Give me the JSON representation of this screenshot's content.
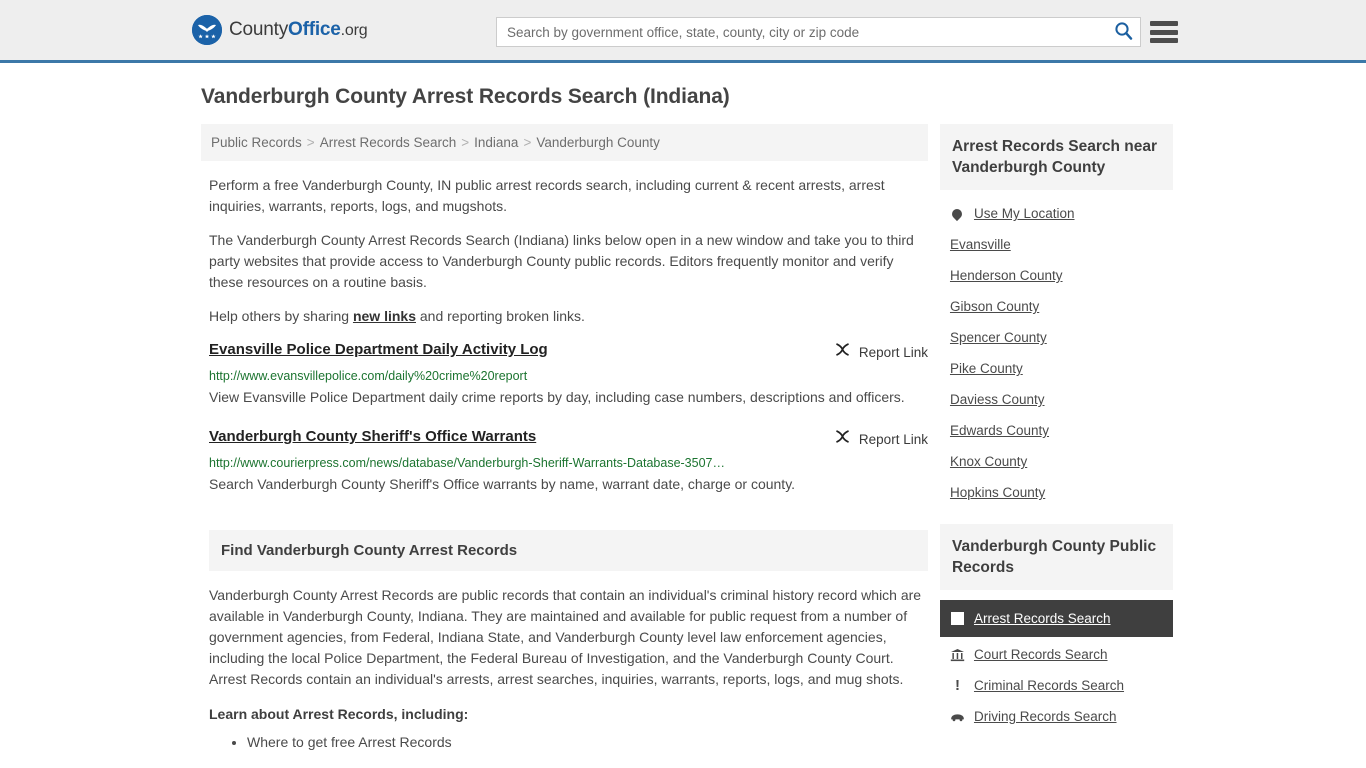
{
  "header": {
    "logo": {
      "icon": "eagle-seal-icon",
      "text_county": "County",
      "text_office": "Office",
      "text_org": ".org"
    },
    "search": {
      "placeholder": "Search by government office, state, county, city or zip code",
      "value": "",
      "icon": "search-icon"
    },
    "menu_icon": "hamburger-menu-icon"
  },
  "page": {
    "title": "Vanderburgh County Arrest Records Search (Indiana)"
  },
  "breadcrumb": {
    "separator": ">",
    "items": [
      {
        "label": "Public Records"
      },
      {
        "label": "Arrest Records Search"
      },
      {
        "label": "Indiana"
      },
      {
        "label": "Vanderburgh County"
      }
    ]
  },
  "intro": {
    "p1": "Perform a free Vanderburgh County, IN public arrest records search, including current & recent arrests, arrest inquiries, warrants, reports, logs, and mugshots.",
    "p2": "The Vanderburgh County Arrest Records Search (Indiana) links below open in a new window and take you to third party websites that provide access to Vanderburgh County public records. Editors frequently monitor and verify these resources on a routine basis.",
    "p3_before": "Help others by sharing ",
    "p3_link": "new links",
    "p3_after": " and reporting broken links."
  },
  "results": {
    "report_label": "Report Link",
    "report_icon": "broken-link-icon",
    "items": [
      {
        "title": "Evansville Police Department Daily Activity Log",
        "url": "http://www.evansvillepolice.com/daily%20crime%20report",
        "description": "View Evansville Police Department daily crime reports by day, including case numbers, descriptions and officers."
      },
      {
        "title": "Vanderburgh County Sheriff's Office Warrants",
        "url": "http://www.courierpress.com/news/database/Vanderburgh-Sheriff-Warrants-Database-3507…",
        "description": "Search Vanderburgh County Sheriff's Office warrants by name, warrant date, charge or county."
      }
    ]
  },
  "find_section": {
    "heading": "Find Vanderburgh County Arrest Records",
    "body": "Vanderburgh County Arrest Records are public records that contain an individual's criminal history record which are available in Vanderburgh County, Indiana. They are maintained and available for public request from a number of government agencies, from Federal, Indiana State, and Vanderburgh County level law enforcement agencies, including the local Police Department, the Federal Bureau of Investigation, and the Vanderburgh County Court. Arrest Records contain an individual's arrests, arrest searches, inquiries, warrants, reports, logs, and mug shots.",
    "learn_heading": "Learn about Arrest Records, including:",
    "learn_items": [
      "Where to get free Arrest Records"
    ]
  },
  "sidebar": {
    "nearby": {
      "heading": "Arrest Records Search near Vanderburgh County",
      "items": [
        {
          "label": "Use My Location",
          "icon": "map-pin-icon"
        },
        {
          "label": "Evansville",
          "icon": ""
        },
        {
          "label": "Henderson County",
          "icon": ""
        },
        {
          "label": "Gibson County",
          "icon": ""
        },
        {
          "label": "Spencer County",
          "icon": ""
        },
        {
          "label": "Pike County",
          "icon": ""
        },
        {
          "label": "Daviess County",
          "icon": ""
        },
        {
          "label": "Edwards County",
          "icon": ""
        },
        {
          "label": "Knox County",
          "icon": ""
        },
        {
          "label": "Hopkins County",
          "icon": ""
        }
      ]
    },
    "public_records": {
      "heading": "Vanderburgh County Public Records",
      "items": [
        {
          "label": "Arrest Records Search",
          "icon": "handcuffs-icon",
          "active": true
        },
        {
          "label": "Court Records Search",
          "icon": "courthouse-icon",
          "active": false
        },
        {
          "label": "Criminal Records Search",
          "icon": "exclamation-icon",
          "active": false
        },
        {
          "label": "Driving Records Search",
          "icon": "car-icon",
          "active": false
        }
      ]
    }
  },
  "colors": {
    "accent_blue": "#1b62a8",
    "header_border": "#3c78a8",
    "url_green": "#1c7430",
    "panel_gray": "#f4f4f4",
    "active_dark": "#3f3f3f"
  }
}
